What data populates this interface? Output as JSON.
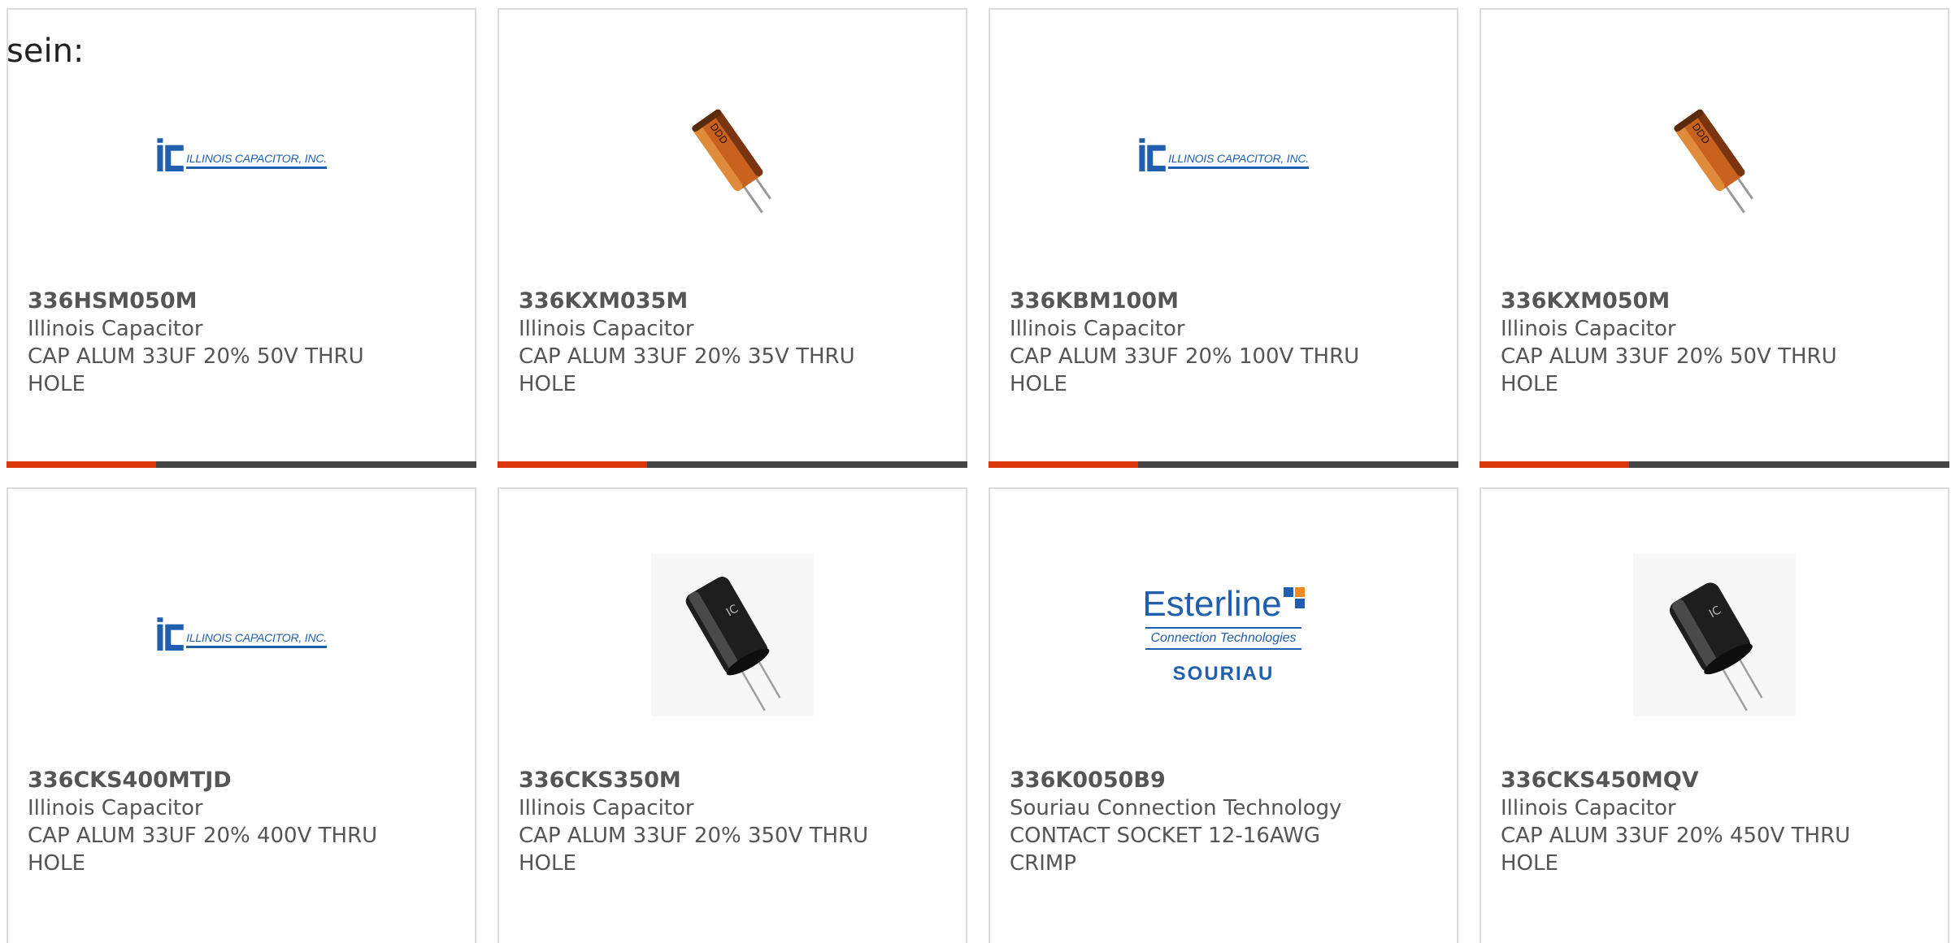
{
  "intro_text": "sein:",
  "colors": {
    "accent": "#d9380f",
    "bar": "#444444",
    "logo_blue": "#1f5fae",
    "card_border": "#dcdcdc",
    "text": "#555555"
  },
  "products": [
    {
      "part_number": "336HSM050M",
      "manufacturer": "Illinois Capacitor",
      "description": "CAP ALUM 33UF 20% 50V THRU HOLE",
      "image": "illinois-capacitor-logo",
      "logo_text": "ILLINOIS CAPACITOR, INC."
    },
    {
      "part_number": "336KXM035M",
      "manufacturer": "Illinois Capacitor",
      "description": "CAP ALUM 33UF 20% 35V THRU HOLE",
      "image": "orange-capacitor-photo"
    },
    {
      "part_number": "336KBM100M",
      "manufacturer": "Illinois Capacitor",
      "description": "CAP ALUM 33UF 20% 100V THRU HOLE",
      "image": "illinois-capacitor-logo",
      "logo_text": "ILLINOIS CAPACITOR, INC."
    },
    {
      "part_number": "336KXM050M",
      "manufacturer": "Illinois Capacitor",
      "description": "CAP ALUM 33UF 20% 50V THRU HOLE",
      "image": "orange-capacitor-photo"
    },
    {
      "part_number": "336CKS400MTJD",
      "manufacturer": "Illinois Capacitor",
      "description": "CAP ALUM 33UF 20% 400V THRU HOLE",
      "image": "illinois-capacitor-logo",
      "logo_text": "ILLINOIS CAPACITOR, INC."
    },
    {
      "part_number": "336CKS350M",
      "manufacturer": "Illinois Capacitor",
      "description": "CAP ALUM 33UF 20% 350V THRU HOLE",
      "image": "black-capacitor-photo"
    },
    {
      "part_number": "336K0050B9",
      "manufacturer": "Souriau Connection Technology",
      "description": "CONTACT SOCKET 12-16AWG CRIMP",
      "image": "esterline-souriau-logo",
      "logo_text": {
        "brand": "Esterline",
        "sub": "Connection Technologies",
        "name": "SOURIAU"
      }
    },
    {
      "part_number": "336CKS450MQV",
      "manufacturer": "Illinois Capacitor",
      "description": "CAP ALUM 33UF 20% 450V THRU HOLE",
      "image": "black-capacitor-photo"
    }
  ]
}
